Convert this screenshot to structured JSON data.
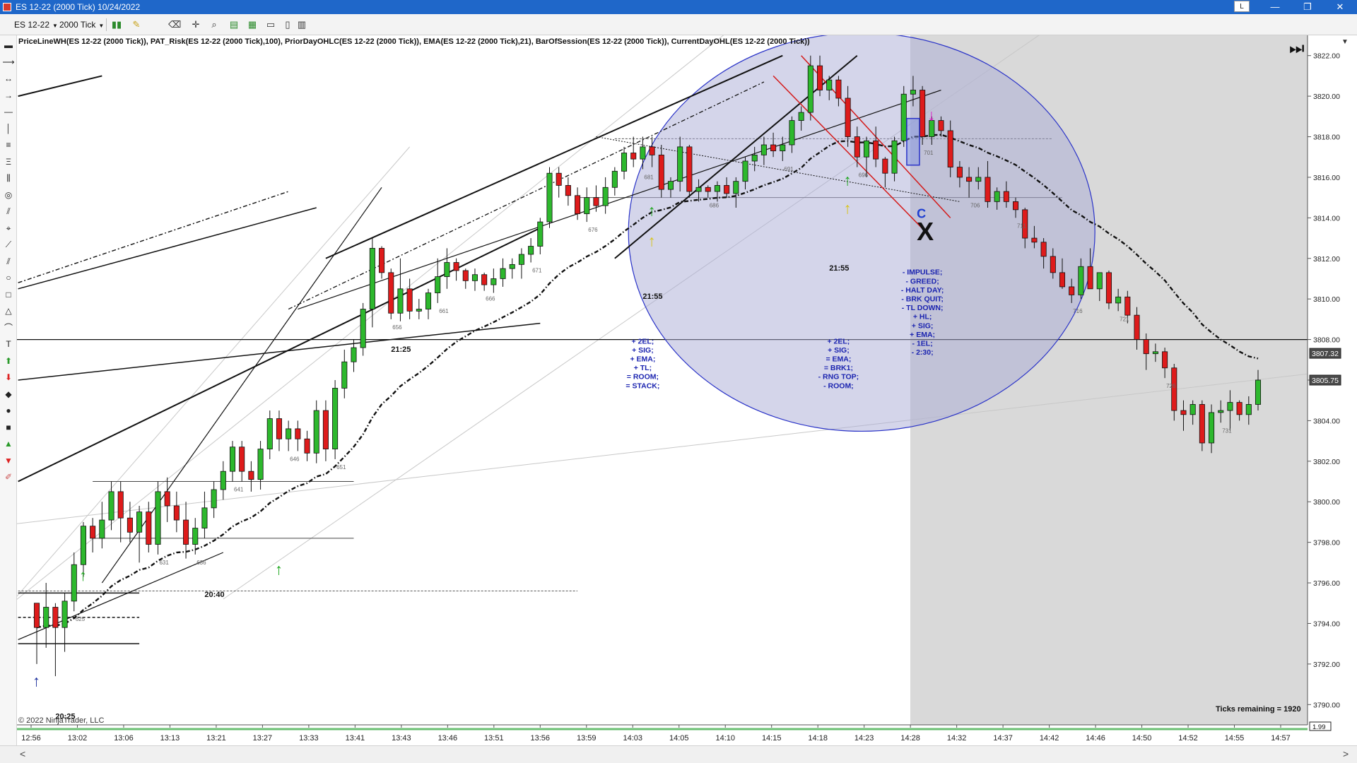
{
  "window": {
    "title": "ES 12-22 (2000 Tick)  10/24/2022",
    "link_button": "L",
    "minimize_icon": "—",
    "restore_icon": "❐",
    "close_icon": "✕"
  },
  "toolbar": {
    "instrument": "ES 12-22",
    "interval": "2000 Tick",
    "icons": [
      "bar-type-icon",
      "pencil-icon",
      "eraser-icon",
      "crosshair-icon",
      "zoom-icon",
      "data-box-icon",
      "chart-style-icon",
      "properties-icon",
      "strategy-icon"
    ]
  },
  "drawing_tools": [
    "line-icon",
    "ray-icon",
    "extended-line-icon",
    "arrow-line-icon",
    "horizontal-line-icon",
    "vertical-line-icon",
    "fibonacci-icon",
    "fib-extension-icon",
    "andrews-pitchfork-icon",
    "gann-fan-icon",
    "regression-channel-icon",
    "risk-reward-icon",
    "ruler-icon",
    "parallel-lines-icon",
    "ellipse-icon",
    "rectangle-icon",
    "triangle-icon",
    "arc-icon",
    "text-icon",
    "arrow-up-icon",
    "arrow-down-icon",
    "diamond-icon",
    "dot-icon",
    "square-icon",
    "triangle-up-icon",
    "triangle-down-icon",
    "stay-in-draw-mode-icon"
  ],
  "scroll": {
    "left": "<",
    "right": ">"
  },
  "chart_data": {
    "type": "candlestick",
    "title": "PriceLineWH(ES 12-22 (2000 Tick)), PAT_Risk(ES 12-22 (2000 Tick),100), PriorDayOHLC(ES 12-22 (2000 Tick)), EMA(ES 12-22 (2000 Tick),21), BarOfSession(ES 12-22 (2000 Tick)), CurrentDayOHL(ES 12-22 (2000 Tick))",
    "copyright": "© 2022 NinjaTrader, LLC",
    "ticks_remaining": "Ticks remaining = 1920",
    "price_axis": {
      "min": 3789,
      "max": 3823,
      "tick_step": 2
    },
    "price_ticks": [
      "3822.00",
      "3820.00",
      "3818.00",
      "3816.00",
      "3814.00",
      "3812.00",
      "3810.00",
      "3808.00",
      "3806.00",
      "3804.00",
      "3802.00",
      "3800.00",
      "3798.00",
      "3796.00",
      "3794.00",
      "3792.00",
      "3790.00"
    ],
    "time_ticks": [
      "12:56",
      "13:02",
      "13:06",
      "13:13",
      "13:21",
      "13:27",
      "13:33",
      "13:41",
      "13:43",
      "13:46",
      "13:51",
      "13:56",
      "13:59",
      "14:03",
      "14:05",
      "14:10",
      "14:15",
      "14:18",
      "14:23",
      "14:28",
      "14:32",
      "14:37",
      "14:42",
      "14:46",
      "14:50",
      "14:52",
      "14:55",
      "14:57"
    ],
    "current_price_label": "3807.32",
    "last_price_label": "3805.75",
    "ema_period": 21,
    "bars": [
      [
        3795.0,
        3795.0,
        3792.0,
        3793.8
      ],
      [
        3793.8,
        3796.0,
        3792.8,
        3794.8
      ],
      [
        3794.8,
        3795.0,
        3791.4,
        3793.8
      ],
      [
        3793.8,
        3795.5,
        3792.6,
        3795.1
      ],
      [
        3795.1,
        3797.5,
        3794.6,
        3796.9
      ],
      [
        3796.9,
        3799.0,
        3796.3,
        3798.8
      ],
      [
        3798.8,
        3799.2,
        3797.5,
        3798.2
      ],
      [
        3798.2,
        3800.0,
        3797.7,
        3799.1
      ],
      [
        3799.1,
        3801.0,
        3798.6,
        3800.5
      ],
      [
        3800.5,
        3801.0,
        3798.0,
        3799.2
      ],
      [
        3799.2,
        3800.0,
        3798.0,
        3798.5
      ],
      [
        3798.5,
        3799.8,
        3797.0,
        3799.5
      ],
      [
        3799.5,
        3800.0,
        3797.5,
        3797.9
      ],
      [
        3797.9,
        3801.0,
        3797.4,
        3800.5
      ],
      [
        3800.5,
        3801.2,
        3799.0,
        3799.8
      ],
      [
        3799.8,
        3800.5,
        3798.5,
        3799.1
      ],
      [
        3799.1,
        3800.0,
        3797.2,
        3797.9
      ],
      [
        3797.9,
        3799.2,
        3797.4,
        3798.7
      ],
      [
        3798.7,
        3800.5,
        3798.2,
        3799.7
      ],
      [
        3799.7,
        3801.0,
        3799.2,
        3800.6
      ],
      [
        3800.6,
        3802.0,
        3800.1,
        3801.5
      ],
      [
        3801.5,
        3803.0,
        3801.0,
        3802.7
      ],
      [
        3802.7,
        3803.0,
        3801.0,
        3801.5
      ],
      [
        3801.5,
        3802.0,
        3800.5,
        3801.1
      ],
      [
        3801.1,
        3803.0,
        3800.6,
        3802.6
      ],
      [
        3802.6,
        3804.5,
        3802.1,
        3804.1
      ],
      [
        3804.1,
        3804.5,
        3802.5,
        3803.1
      ],
      [
        3803.1,
        3804.0,
        3802.5,
        3803.6
      ],
      [
        3803.6,
        3804.0,
        3802.5,
        3803.1
      ],
      [
        3803.1,
        3803.5,
        3802.0,
        3802.4
      ],
      [
        3802.4,
        3805.0,
        3801.9,
        3804.5
      ],
      [
        3804.5,
        3805.0,
        3802.0,
        3802.6
      ],
      [
        3802.6,
        3806.0,
        3802.1,
        3805.6
      ],
      [
        3805.6,
        3807.5,
        3805.1,
        3806.9
      ],
      [
        3806.9,
        3808.0,
        3806.4,
        3807.6
      ],
      [
        3807.6,
        3809.8,
        3807.2,
        3809.5
      ],
      [
        3809.5,
        3813.0,
        3808.6,
        3812.5
      ],
      [
        3812.5,
        3812.6,
        3811.0,
        3811.3
      ],
      [
        3811.3,
        3811.5,
        3809.0,
        3809.3
      ],
      [
        3809.3,
        3812.0,
        3808.9,
        3810.5
      ],
      [
        3810.5,
        3811.0,
        3809.0,
        3809.4
      ],
      [
        3809.4,
        3810.0,
        3809.0,
        3809.5
      ],
      [
        3809.5,
        3810.5,
        3809.0,
        3810.3
      ],
      [
        3810.3,
        3812.0,
        3809.8,
        3811.1
      ],
      [
        3811.1,
        3812.5,
        3810.5,
        3811.8
      ],
      [
        3811.8,
        3812.0,
        3810.9,
        3811.4
      ],
      [
        3811.4,
        3811.5,
        3810.5,
        3810.9
      ],
      [
        3810.9,
        3811.5,
        3810.4,
        3811.2
      ],
      [
        3811.2,
        3811.3,
        3810.4,
        3810.7
      ],
      [
        3810.7,
        3811.5,
        3810.3,
        3811.0
      ],
      [
        3811.0,
        3812.0,
        3810.6,
        3811.5
      ],
      [
        3811.5,
        3812.0,
        3811.0,
        3811.7
      ],
      [
        3811.7,
        3812.5,
        3811.0,
        3812.2
      ],
      [
        3812.2,
        3813.0,
        3811.8,
        3812.6
      ],
      [
        3812.6,
        3814.0,
        3812.2,
        3813.8
      ],
      [
        3813.8,
        3816.5,
        3813.5,
        3816.2
      ],
      [
        3816.2,
        3816.5,
        3815.0,
        3815.6
      ],
      [
        3815.6,
        3816.0,
        3814.6,
        3815.1
      ],
      [
        3815.1,
        3815.5,
        3813.9,
        3814.2
      ],
      [
        3814.2,
        3815.5,
        3813.8,
        3815.0
      ],
      [
        3815.0,
        3815.6,
        3814.3,
        3814.6
      ],
      [
        3814.6,
        3816.0,
        3814.2,
        3815.5
      ],
      [
        3815.5,
        3816.5,
        3815.1,
        3816.3
      ],
      [
        3816.3,
        3817.5,
        3815.9,
        3817.2
      ],
      [
        3817.2,
        3818.0,
        3816.5,
        3816.9
      ],
      [
        3816.9,
        3818.0,
        3816.4,
        3817.5
      ],
      [
        3817.5,
        3818.0,
        3816.5,
        3817.1
      ],
      [
        3817.1,
        3817.6,
        3815.0,
        3815.4
      ],
      [
        3815.4,
        3816.0,
        3815.0,
        3815.8
      ],
      [
        3815.8,
        3818.0,
        3815.3,
        3817.5
      ],
      [
        3817.5,
        3817.6,
        3815.0,
        3815.3
      ],
      [
        3815.3,
        3815.9,
        3814.8,
        3815.5
      ],
      [
        3815.5,
        3815.6,
        3815.0,
        3815.3
      ],
      [
        3815.3,
        3815.8,
        3814.8,
        3815.6
      ],
      [
        3815.6,
        3816.0,
        3815.0,
        3815.2
      ],
      [
        3815.2,
        3816.0,
        3814.5,
        3815.8
      ],
      [
        3815.8,
        3817.0,
        3815.4,
        3816.8
      ],
      [
        3816.8,
        3817.5,
        3816.3,
        3817.1
      ],
      [
        3817.1,
        3818.0,
        3816.6,
        3817.6
      ],
      [
        3817.6,
        3818.2,
        3817.0,
        3817.3
      ],
      [
        3817.3,
        3818.0,
        3816.8,
        3817.6
      ],
      [
        3817.6,
        3819.0,
        3817.2,
        3818.8
      ],
      [
        3818.8,
        3819.5,
        3818.3,
        3819.2
      ],
      [
        3819.2,
        3822.0,
        3818.8,
        3821.5
      ],
      [
        3821.5,
        3822.0,
        3820.0,
        3820.3
      ],
      [
        3820.3,
        3821.0,
        3819.8,
        3820.8
      ],
      [
        3820.8,
        3821.0,
        3819.5,
        3819.9
      ],
      [
        3819.9,
        3820.5,
        3817.5,
        3818.0
      ],
      [
        3818.0,
        3818.5,
        3816.5,
        3817.0
      ],
      [
        3817.0,
        3818.0,
        3816.0,
        3817.8
      ],
      [
        3817.8,
        3818.5,
        3816.5,
        3816.9
      ],
      [
        3816.9,
        3817.0,
        3815.5,
        3816.2
      ],
      [
        3816.2,
        3818.0,
        3815.8,
        3817.8
      ],
      [
        3817.8,
        3820.5,
        3817.5,
        3820.1
      ],
      [
        3820.1,
        3821.0,
        3819.5,
        3820.3
      ],
      [
        3820.3,
        3820.5,
        3817.6,
        3818.0
      ],
      [
        3818.0,
        3819.0,
        3817.6,
        3818.8
      ],
      [
        3818.8,
        3819.0,
        3818.0,
        3818.3
      ],
      [
        3818.3,
        3818.8,
        3816.0,
        3816.5
      ],
      [
        3816.5,
        3816.8,
        3815.5,
        3816.0
      ],
      [
        3816.0,
        3816.5,
        3815.0,
        3815.8
      ],
      [
        3815.8,
        3816.5,
        3815.4,
        3816.0
      ],
      [
        3816.0,
        3816.8,
        3814.5,
        3814.8
      ],
      [
        3814.8,
        3815.5,
        3814.4,
        3815.3
      ],
      [
        3815.3,
        3815.8,
        3814.5,
        3814.8
      ],
      [
        3814.8,
        3815.0,
        3814.0,
        3814.4
      ],
      [
        3814.4,
        3814.5,
        3812.5,
        3813.0
      ],
      [
        3813.0,
        3813.6,
        3812.5,
        3812.8
      ],
      [
        3812.8,
        3813.0,
        3811.5,
        3812.1
      ],
      [
        3812.1,
        3812.5,
        3811.0,
        3811.3
      ],
      [
        3811.3,
        3812.0,
        3810.5,
        3810.6
      ],
      [
        3810.6,
        3811.0,
        3809.8,
        3810.2
      ],
      [
        3810.2,
        3812.0,
        3810.0,
        3811.6
      ],
      [
        3811.6,
        3812.5,
        3811.0,
        3810.5
      ],
      [
        3810.5,
        3811.0,
        3809.9,
        3811.3
      ],
      [
        3811.3,
        3811.4,
        3809.5,
        3809.8
      ],
      [
        3809.8,
        3810.5,
        3809.4,
        3810.1
      ],
      [
        3810.1,
        3810.4,
        3808.8,
        3809.2
      ],
      [
        3809.2,
        3809.6,
        3807.5,
        3808.0
      ],
      [
        3808.0,
        3808.3,
        3806.5,
        3807.3
      ],
      [
        3807.3,
        3807.8,
        3806.9,
        3807.4
      ],
      [
        3807.4,
        3807.6,
        3806.1,
        3806.6
      ],
      [
        3806.6,
        3806.8,
        3804.0,
        3804.5
      ],
      [
        3804.5,
        3805.0,
        3803.5,
        3804.3
      ],
      [
        3804.3,
        3805.0,
        3803.8,
        3804.8
      ],
      [
        3804.8,
        3805.0,
        3802.5,
        3802.9
      ],
      [
        3802.9,
        3804.8,
        3802.4,
        3804.4
      ],
      [
        3804.4,
        3805.0,
        3803.9,
        3804.5
      ],
      [
        3804.5,
        3805.5,
        3803.5,
        3804.9
      ],
      [
        3804.9,
        3805.0,
        3804.0,
        3804.3
      ],
      [
        3804.3,
        3805.2,
        3803.8,
        3804.8
      ],
      [
        3804.8,
        3806.5,
        3804.5,
        3806.0
      ]
    ],
    "bar_numbers": [
      {
        "i": 4,
        "label": "625"
      },
      {
        "i": 13,
        "label": "631"
      },
      {
        "i": 17,
        "label": "636"
      },
      {
        "i": 21,
        "label": "641"
      },
      {
        "i": 27,
        "label": "646"
      },
      {
        "i": 32,
        "label": "651"
      },
      {
        "i": 38,
        "label": "656"
      },
      {
        "i": 43,
        "label": "661"
      },
      {
        "i": 48,
        "label": "666"
      },
      {
        "i": 53,
        "label": "671"
      },
      {
        "i": 59,
        "label": "676"
      },
      {
        "i": 65,
        "label": "681"
      },
      {
        "i": 72,
        "label": "686"
      },
      {
        "i": 80,
        "label": "691"
      },
      {
        "i": 88,
        "label": "696"
      },
      {
        "i": 95,
        "label": "701"
      },
      {
        "i": 100,
        "label": "706"
      },
      {
        "i": 105,
        "label": "711"
      },
      {
        "i": 111,
        "label": "716"
      },
      {
        "i": 116,
        "label": "721"
      },
      {
        "i": 121,
        "label": "726"
      },
      {
        "i": 127,
        "label": "731"
      }
    ],
    "time_labels": [
      {
        "i": 2,
        "p": 3789.3,
        "text": "20:25"
      },
      {
        "i": 18,
        "p": 3795.3,
        "text": "20:40"
      },
      {
        "i": 38,
        "p": 3807.4,
        "text": "21:25"
      },
      {
        "i": 65,
        "p": 3810.0,
        "text": "21:55"
      },
      {
        "i": 85,
        "p": 3811.4,
        "text": "21:55"
      }
    ],
    "annotations": [
      {
        "i": 65,
        "p": 3807.8,
        "lines": [
          "+ 2EL;",
          "+ SIG;",
          "+ EMA;",
          "+ TL;",
          "= ROOM;",
          "= STACK;"
        ]
      },
      {
        "i": 86,
        "p": 3807.8,
        "lines": [
          "+ 2EL;",
          "+ SIG;",
          "= EMA;",
          "= BRK1;",
          "- RNG TOP;",
          "- ROOM;"
        ]
      },
      {
        "i": 95,
        "p": 3811.2,
        "lines": [
          "- IMPULSE;",
          "- GREED;",
          "- HALT DAY;",
          "- BRK QUIT;",
          "- TL DOWN;",
          "+ HL;",
          "+ SIG;",
          "+ EMA;",
          "- 1EL;",
          "- 2:30;"
        ]
      }
    ],
    "signal_markers": [
      {
        "i": 5,
        "p": 3796.1,
        "text": "↑",
        "color": "#1aa51a"
      },
      {
        "i": 26,
        "p": 3796.4,
        "text": "↑",
        "color": "#1aa51a"
      },
      {
        "i": 66,
        "p": 3814.1,
        "text": "↑",
        "color": "#1aa51a"
      },
      {
        "i": 66,
        "p": 3812.6,
        "text": "↑",
        "color": "#d8c41a"
      },
      {
        "i": 87,
        "p": 3815.6,
        "text": "↑",
        "color": "#1aa51a"
      },
      {
        "i": 87,
        "p": 3814.2,
        "text": "↑",
        "color": "#d8c41a"
      },
      {
        "i": 0,
        "p": 3790.9,
        "text": "↑",
        "color": "#1b2d9c"
      },
      {
        "i": 96,
        "p": 3818.8,
        "text": "↓",
        "color": "#e11ac8"
      }
    ],
    "setup_labels": [
      {
        "i": 95,
        "p": 3814.0,
        "text": "C",
        "color": "#1f3fd1"
      },
      {
        "i": 95,
        "p": 3812.9,
        "text": "X",
        "color": "#111111"
      }
    ],
    "prior_day_level": 3808.0,
    "colors": {
      "up": "#2db82d",
      "down": "#de1b1b",
      "ema": "#111111",
      "ellipse_fill": "#a9acd6",
      "ellipse_stroke": "#2a33c8",
      "shade": "#d9d9d9",
      "channel": "#d41a1a"
    }
  }
}
